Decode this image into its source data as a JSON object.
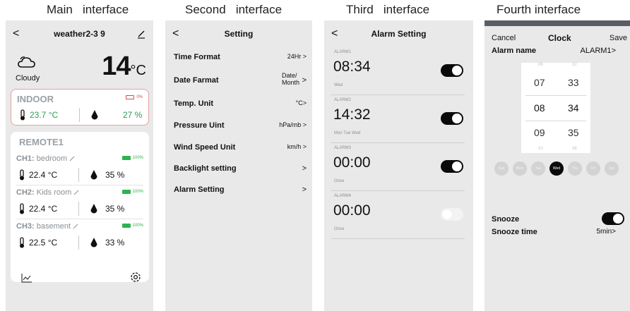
{
  "captions": {
    "main": "Main   interface",
    "second": "Second   interface",
    "third": "Third   interface",
    "fourth": "Fourth interface"
  },
  "main": {
    "back": "<",
    "title": "weather2-3 9",
    "condition": "Cloudy",
    "temperature": "14",
    "temp_unit": "°C",
    "indoor": {
      "label": "INDOOR",
      "battery": "0%",
      "temp": "23.7 °C",
      "humidity": "27 %"
    },
    "remote": {
      "label": "REMOTE1",
      "channels": [
        {
          "ch": "CH1:",
          "name": "bedroom",
          "battery": "100%",
          "temp": "22.4 °C",
          "humidity": "35 %"
        },
        {
          "ch": "CH2:",
          "name": "Kids room",
          "battery": "100%",
          "temp": "22.4 °C",
          "humidity": "35 %"
        },
        {
          "ch": "CH3:",
          "name": "basement",
          "battery": "100%",
          "temp": "22.5 °C",
          "humidity": "33 %"
        }
      ]
    }
  },
  "settings": {
    "back": "<",
    "title": "Setting",
    "rows": [
      {
        "label": "Time Format",
        "value": "24Hr",
        "chevron": ">"
      },
      {
        "label": "Date Farmat",
        "value1": "Date/",
        "value2": "Month",
        "chevron": ">"
      },
      {
        "label": "Temp. Unit",
        "value": "°C",
        "chevron": ">"
      },
      {
        "label": "Pressure Uint",
        "value": "hPa/mb",
        "chevron": ">"
      },
      {
        "label": "Wind Speed Unit",
        "value": "km/h",
        "chevron": ">"
      },
      {
        "label": "Backlight setting",
        "value": "",
        "chevron": ">"
      },
      {
        "label": "Alarm Setting",
        "value": "",
        "chevron": ">"
      }
    ]
  },
  "alarms": {
    "back": "<",
    "title": "Alarm Setting",
    "items": [
      {
        "name": "ALARM1",
        "time": "08:34",
        "days": "Wed",
        "enabled": true
      },
      {
        "name": "ALARM2",
        "time": "14:32",
        "days": "Mon Tue Wed",
        "enabled": true
      },
      {
        "name": "ALARM3",
        "time": "00:00",
        "days": "Once",
        "enabled": true
      },
      {
        "name": "ALARM4",
        "time": "00:00",
        "days": "Once",
        "enabled": false
      }
    ]
  },
  "clock": {
    "cancel": "Cancel",
    "title": "Clock",
    "save": "Save",
    "alarm_name_label": "Alarm name",
    "alarm_name_value": "ALARM1",
    "chevron": ">",
    "hours": [
      "06",
      "07",
      "08",
      "09",
      "10"
    ],
    "minutes": [
      "32",
      "33",
      "34",
      "35",
      "36"
    ],
    "selected_hour": "08",
    "selected_minute": "34",
    "days": [
      "Sun",
      "Mon",
      "Tue",
      "Wed",
      "Thu",
      "Fri",
      "Sat"
    ],
    "selected_day": "Wed",
    "snooze_label": "Snooze",
    "snooze_enabled": true,
    "snooze_time_label": "Snooze time",
    "snooze_time_value": "5min"
  },
  "colors": {
    "panel_bg": "#e9e9e9",
    "indoor_green": "#2c9c57",
    "battery_green": "#2fb34e",
    "battery_red": "#d24a4a",
    "toggle_on": "#0a0a0a"
  }
}
